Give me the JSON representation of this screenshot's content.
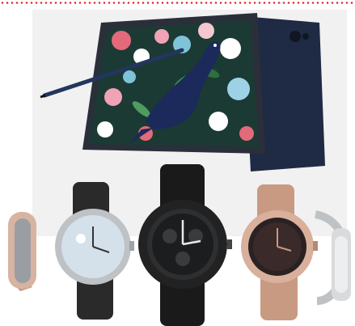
{
  "photo": {
    "products": [
      "tablet",
      "stylus-pen",
      "watch",
      "watch",
      "watch",
      "watch"
    ]
  },
  "colors": {
    "accent_dots": "#e03030",
    "tablet_body": "#1f2a44",
    "tablet_frame": "#2a2f3a",
    "bird": "#1b2a5a",
    "watch_black": "#222222",
    "watch_rose": "#c99a82",
    "watch_silver": "#bfc2c5",
    "backdrop": "#f1f1f1"
  }
}
